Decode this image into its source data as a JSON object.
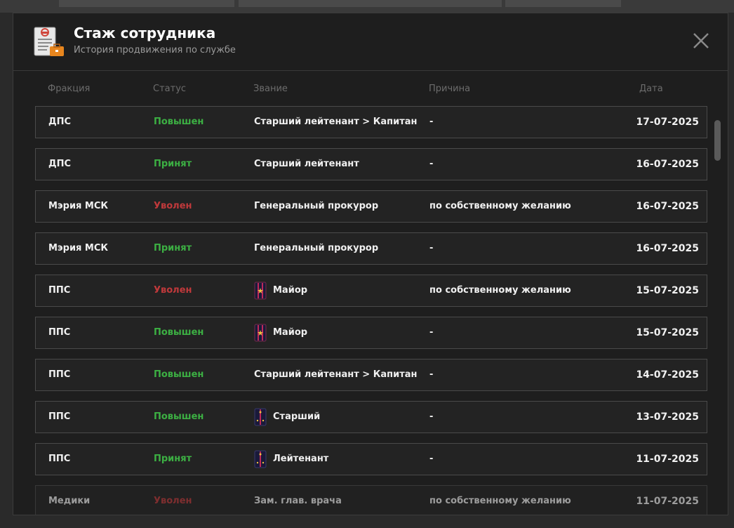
{
  "header": {
    "title": "Стаж сотрудника",
    "subtitle": "История продвижения по службе"
  },
  "columns": {
    "faction": "Фракция",
    "status": "Статус",
    "rank": "Звание",
    "reason": "Причина",
    "date": "Дата"
  },
  "colors": {
    "promoted": "#3cb043",
    "accepted": "#3cb043",
    "fired": "#c0393b"
  },
  "rows": [
    {
      "faction": "ДПС",
      "status": "Повышен",
      "status_type": "green",
      "rank": "Старший лейтенант > Капитан",
      "rank_icon": "",
      "reason": "-",
      "date": "17-07-2025"
    },
    {
      "faction": "ДПС",
      "status": "Принят",
      "status_type": "green",
      "rank": "Старший лейтенант",
      "rank_icon": "",
      "reason": "-",
      "date": "16-07-2025"
    },
    {
      "faction": "Мэрия МСК",
      "status": "Уволен",
      "status_type": "red",
      "rank": "Генеральный прокурор",
      "rank_icon": "",
      "reason": "по собственному желанию",
      "date": "16-07-2025"
    },
    {
      "faction": "Мэрия МСК",
      "status": "Принят",
      "status_type": "green",
      "rank": "Генеральный прокурор",
      "rank_icon": "",
      "reason": "-",
      "date": "16-07-2025"
    },
    {
      "faction": "ППС",
      "status": "Уволен",
      "status_type": "red",
      "rank": "Майор",
      "rank_icon": "major-epaulette-icon",
      "reason": "по собственному желанию",
      "date": "15-07-2025"
    },
    {
      "faction": "ППС",
      "status": "Повышен",
      "status_type": "green",
      "rank": "Майор",
      "rank_icon": "major-epaulette-icon",
      "reason": "-",
      "date": "15-07-2025"
    },
    {
      "faction": "ППС",
      "status": "Повышен",
      "status_type": "green",
      "rank": "Старший лейтенант > Капитан",
      "rank_icon": "",
      "reason": "-",
      "date": "14-07-2025"
    },
    {
      "faction": "ППС",
      "status": "Повышен",
      "status_type": "green",
      "rank": "Старший",
      "rank_icon": "junior-epaulette-icon",
      "reason": "-",
      "date": "13-07-2025"
    },
    {
      "faction": "ППС",
      "status": "Принят",
      "status_type": "green",
      "rank": "Лейтенант",
      "rank_icon": "lieutenant-epaulette-icon",
      "reason": "-",
      "date": "11-07-2025"
    },
    {
      "faction": "Медики",
      "status": "Уволен",
      "status_type": "red",
      "rank": "Зам. глав. врача",
      "rank_icon": "",
      "reason": "по собственному желанию",
      "date": "11-07-2025"
    }
  ]
}
